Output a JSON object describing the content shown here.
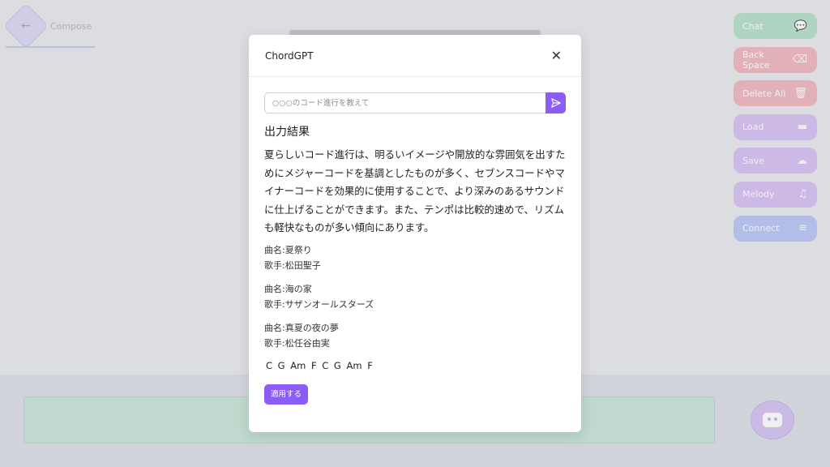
{
  "compose": {
    "label": "Compose"
  },
  "side_buttons": [
    {
      "label": "Chat",
      "icon": "chat-bubble-icon",
      "glyph": "💬",
      "color": "#b8e0cb"
    },
    {
      "label": "Back Space",
      "icon": "backspace-icon",
      "glyph": "⌫",
      "color": "#f0b9bf"
    },
    {
      "label": "Delete All",
      "icon": "trash-icon",
      "glyph": "🗑",
      "color": "#f0b9bf"
    },
    {
      "label": "Load",
      "icon": "folder-icon",
      "glyph": "▬",
      "color": "#d7c2f2"
    },
    {
      "label": "Save",
      "icon": "cloud-upload-icon",
      "glyph": "☁",
      "color": "#d7c2f2"
    },
    {
      "label": "Melody",
      "icon": "music-note-icon",
      "glyph": "♫",
      "color": "#d7c2f2"
    },
    {
      "label": "Connect",
      "icon": "wifi-icon",
      "glyph": "≋",
      "color": "#bcc8f5"
    }
  ],
  "modal": {
    "title": "ChordGPT",
    "close_glyph": "✕",
    "input": {
      "value": "",
      "placeholder": "○○○のコード進行を教えて"
    },
    "result_title": "出力結果",
    "result_text": "夏らしいコード進行は、明るいイメージや開放的な雰囲気を出すためにメジャーコードを基調としたものが多く、セブンスコードやマイナーコードを効果的に使用することで、より深みのあるサウンドに仕上げることができます。また、テンポは比較的速めで、リズムも軽快なものが多い傾向にあります。",
    "songs": [
      {
        "title": "曲名:夏祭り",
        "artist": "歌手:松田聖子"
      },
      {
        "title": "曲名:海の家",
        "artist": "歌手:サザンオールスターズ"
      },
      {
        "title": "曲名:真夏の夜の夢",
        "artist": "歌手:松任谷由実"
      }
    ],
    "chords": "C G Am F C G Am F",
    "apply_label": "適用する"
  },
  "colors": {
    "accent": "#8b5cf6"
  }
}
